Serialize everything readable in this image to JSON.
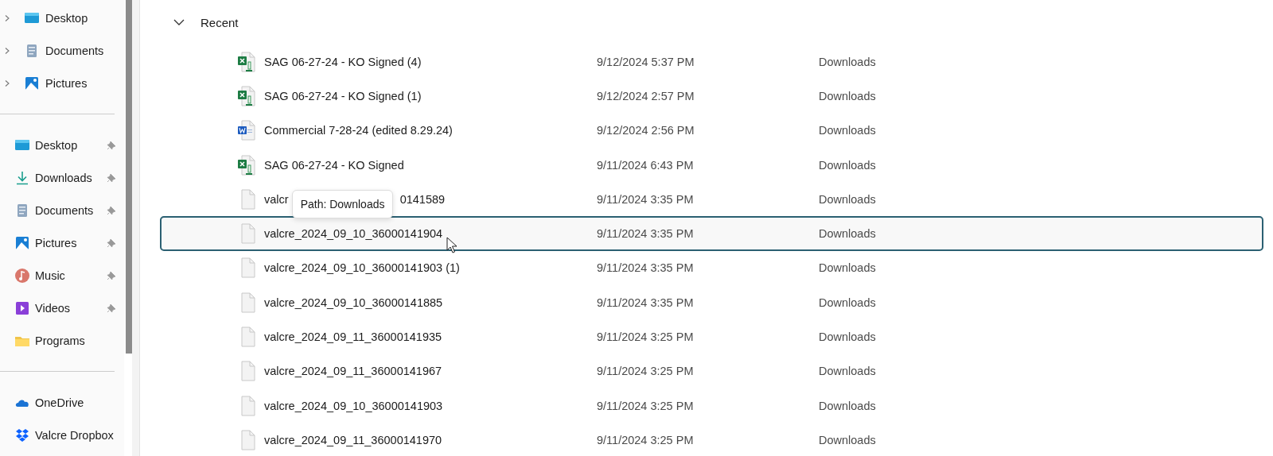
{
  "sidebar": {
    "tree": [
      {
        "label": "Desktop",
        "kind": "desktop",
        "expanded": false
      },
      {
        "label": "Documents",
        "kind": "documents",
        "expanded": false
      },
      {
        "label": "Pictures",
        "kind": "pictures",
        "expanded": false
      }
    ],
    "quick_access": [
      {
        "label": "Desktop",
        "kind": "desktop",
        "pinned": true
      },
      {
        "label": "Downloads",
        "kind": "downloads",
        "pinned": true
      },
      {
        "label": "Documents",
        "kind": "documents",
        "pinned": true
      },
      {
        "label": "Pictures",
        "kind": "pictures",
        "pinned": true
      },
      {
        "label": "Music",
        "kind": "music",
        "pinned": true
      },
      {
        "label": "Videos",
        "kind": "videos",
        "pinned": true
      },
      {
        "label": "Programs",
        "kind": "folder",
        "pinned": false
      }
    ],
    "locations": [
      {
        "label": "OneDrive",
        "kind": "onedrive"
      },
      {
        "label": "Valcre Dropbox",
        "kind": "dropbox"
      }
    ]
  },
  "group": {
    "title": "Recent",
    "expanded": true
  },
  "files": [
    {
      "kind": "excel",
      "name": "SAG 06-27-24 - KO Signed (4)",
      "date": "9/12/2024 5:37 PM",
      "location": "Downloads",
      "selected": false
    },
    {
      "kind": "excel",
      "name": "SAG 06-27-24 - KO Signed (1)",
      "date": "9/12/2024 2:57 PM",
      "location": "Downloads",
      "selected": false
    },
    {
      "kind": "word",
      "name": "Commercial 7-28-24 (edited 8.29.24)",
      "date": "9/12/2024 2:56 PM",
      "location": "Downloads",
      "selected": false
    },
    {
      "kind": "excel",
      "name": "SAG 06-27-24 - KO Signed",
      "date": "9/11/2024 6:43 PM",
      "location": "Downloads",
      "selected": false
    },
    {
      "kind": "file",
      "name": "valcr",
      "name_tail": "0141589",
      "date": "9/11/2024 3:35 PM",
      "location": "Downloads",
      "selected": false,
      "tooltip": "Path: Downloads"
    },
    {
      "kind": "file",
      "name": "valcre_2024_09_10_36000141904",
      "date": "9/11/2024 3:35 PM",
      "location": "Downloads",
      "selected": true,
      "pointer": true
    },
    {
      "kind": "file",
      "name": "valcre_2024_09_10_36000141903 (1)",
      "date": "9/11/2024 3:35 PM",
      "location": "Downloads",
      "selected": false
    },
    {
      "kind": "file",
      "name": "valcre_2024_09_10_36000141885",
      "date": "9/11/2024 3:35 PM",
      "location": "Downloads",
      "selected": false
    },
    {
      "kind": "file",
      "name": "valcre_2024_09_11_36000141935",
      "date": "9/11/2024 3:25 PM",
      "location": "Downloads",
      "selected": false
    },
    {
      "kind": "file",
      "name": "valcre_2024_09_11_36000141967",
      "date": "9/11/2024 3:25 PM",
      "location": "Downloads",
      "selected": false
    },
    {
      "kind": "file",
      "name": "valcre_2024_09_10_36000141903",
      "date": "9/11/2024 3:25 PM",
      "location": "Downloads",
      "selected": false
    },
    {
      "kind": "file",
      "name": "valcre_2024_09_11_36000141970",
      "date": "9/11/2024 3:25 PM",
      "location": "Downloads",
      "selected": false
    }
  ]
}
